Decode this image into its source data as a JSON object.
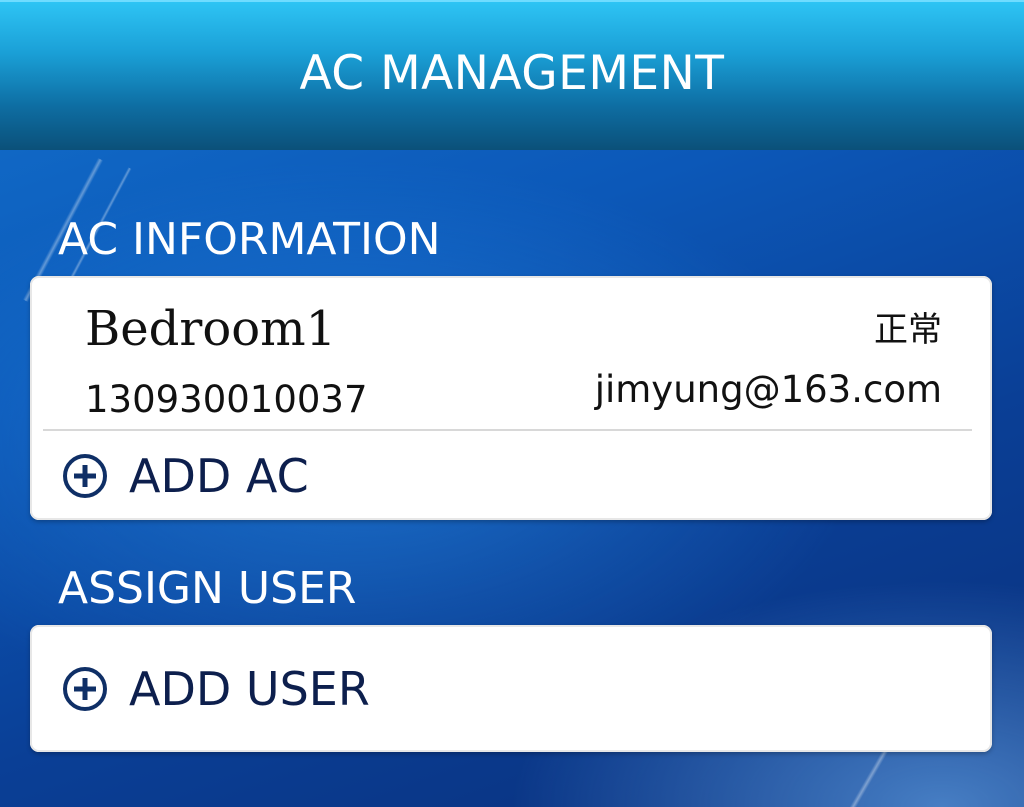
{
  "header": {
    "title": "AC MANAGEMENT"
  },
  "ac_section": {
    "label": "AC INFORMATION",
    "items": [
      {
        "name": "Bedroom1",
        "status": "正常",
        "serial": "130930010037",
        "email": "jimyung@163.com"
      }
    ],
    "add_label": "ADD AC"
  },
  "user_section": {
    "label": "ASSIGN USER",
    "add_label": "ADD USER"
  },
  "colors": {
    "header_top": "#2ec4f4",
    "header_bottom": "#0b5079",
    "background": "#0c58b8",
    "card": "#ffffff",
    "add_text": "#0d1f4d"
  },
  "icons": {
    "add": "plus-circle-icon"
  }
}
